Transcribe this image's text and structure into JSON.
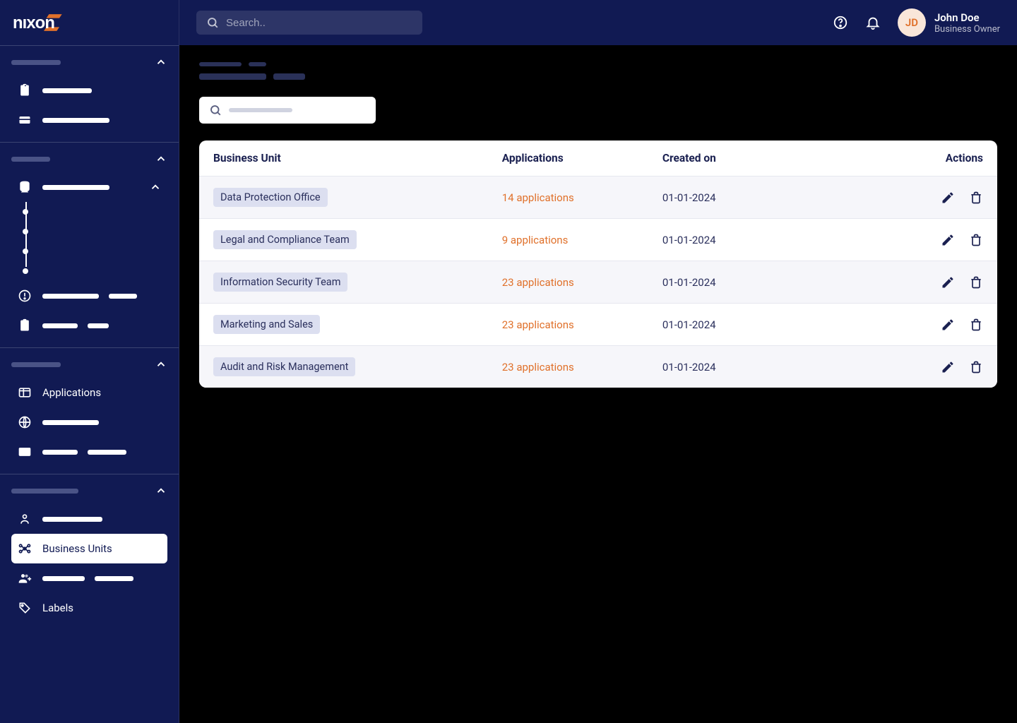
{
  "header": {
    "search_placeholder": "Search..",
    "user": {
      "initials": "JD",
      "name": "John Doe",
      "role": "Business Owner"
    }
  },
  "sidebar": {
    "applications_label": "Applications",
    "business_units_label": "Business Units",
    "labels_label": "Labels"
  },
  "table": {
    "columns": {
      "unit": "Business Unit",
      "apps": "Applications",
      "created": "Created on",
      "actions": "Actions"
    },
    "rows": [
      {
        "name": "Data Protection Office",
        "apps": "14 applications",
        "created": "01-01-2024"
      },
      {
        "name": "Legal and Compliance Team",
        "apps": "9 applications",
        "created": "01-01-2024"
      },
      {
        "name": "Information Security Team",
        "apps": "23 applications",
        "created": "01-01-2024"
      },
      {
        "name": "Marketing and Sales",
        "apps": "23 applications",
        "created": "01-01-2024"
      },
      {
        "name": "Audit and Risk Management",
        "apps": "23 applications",
        "created": "01-01-2024"
      }
    ]
  }
}
